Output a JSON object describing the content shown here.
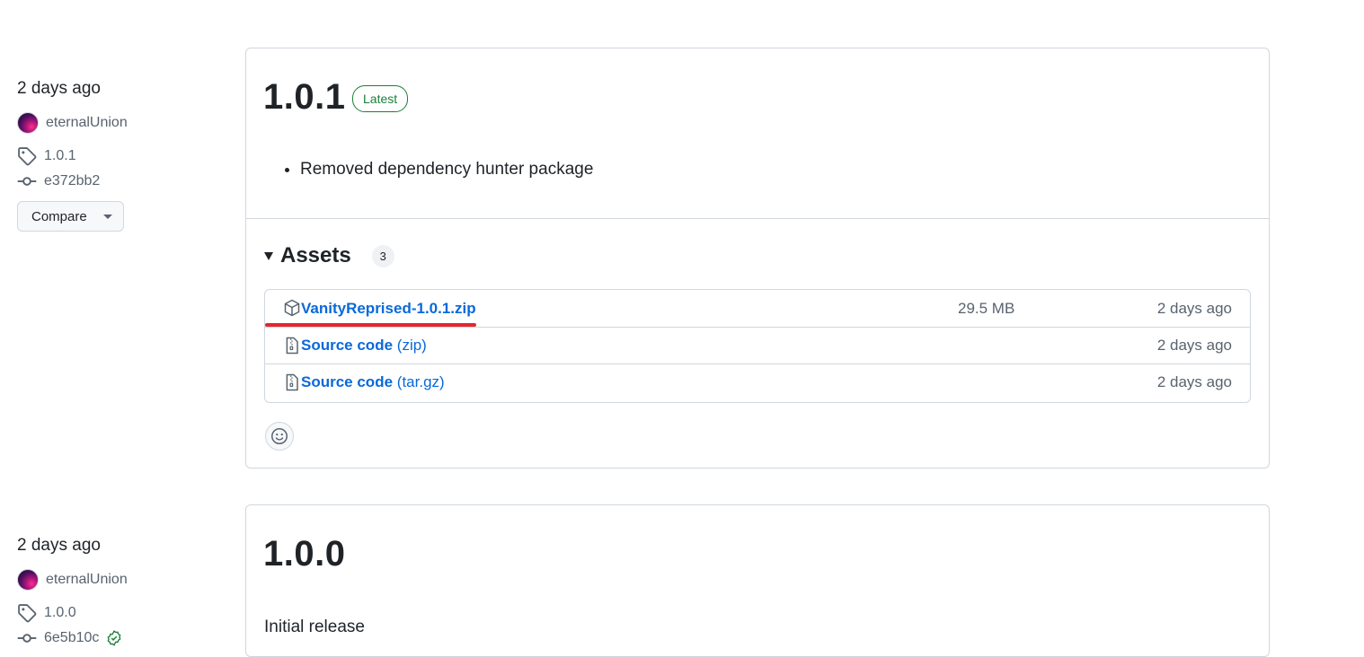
{
  "releases": [
    {
      "date": "2 days ago",
      "author": "eternalUnion",
      "tag": "1.0.1",
      "commit": "e372bb2",
      "compare_label": "Compare",
      "title": "1.0.1",
      "badge": "Latest",
      "notes": [
        "Removed dependency hunter package"
      ],
      "assets_label": "Assets",
      "assets_count": "3",
      "assets": [
        {
          "name": "VanityReprised-1.0.1.zip",
          "suffix": "",
          "size": "29.5 MB",
          "date": "2 days ago",
          "icon": "package-icon"
        },
        {
          "name": "Source code",
          "suffix": "(zip)",
          "size": "",
          "date": "2 days ago",
          "icon": "file-zip-icon"
        },
        {
          "name": "Source code",
          "suffix": "(tar.gz)",
          "size": "",
          "date": "2 days ago",
          "icon": "file-zip-icon"
        }
      ]
    },
    {
      "date": "2 days ago",
      "author": "eternalUnion",
      "tag": "1.0.0",
      "commit": "6e5b10c",
      "title": "1.0.0",
      "body": "Initial release"
    }
  ],
  "colors": {
    "link": "#0969da",
    "latest_badge": "#1a7f37",
    "annotation_underline": "#e3262f",
    "border": "#d0d7de"
  }
}
